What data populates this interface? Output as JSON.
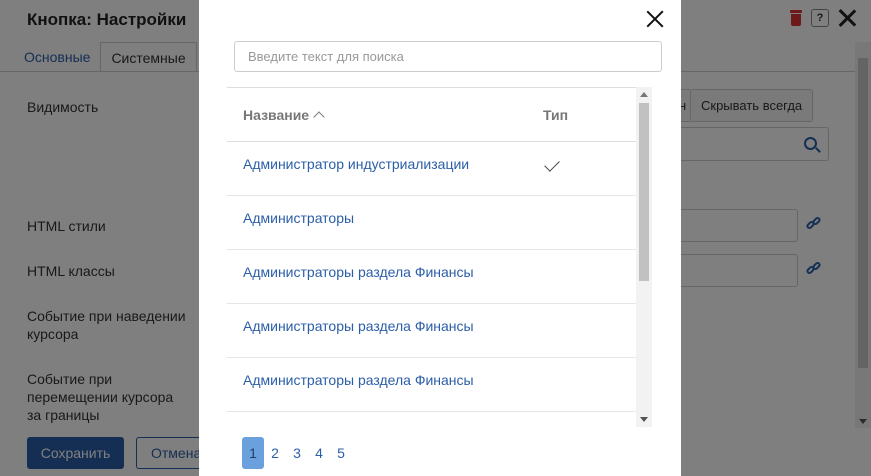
{
  "background": {
    "title": "Кнопка: Настройки",
    "tabs": [
      {
        "label": "Основные"
      },
      {
        "label": "Системные"
      }
    ],
    "labels": {
      "visibility": "Видимость",
      "html_styles": "HTML стили",
      "html_classes": "HTML классы",
      "hover_event": "Событие при наведении курсора",
      "leave_event": "Событие при перемещении курсора за границы"
    },
    "visibility_button_fragment": "н",
    "hide_always_button": "Скрывать всегда",
    "save_button": "Сохранить",
    "cancel_button": "Отмена"
  },
  "modal": {
    "search_placeholder": "Введите текст для поиска",
    "columns": {
      "name": "Название",
      "type": "Тип"
    },
    "rows": [
      {
        "name": "Администратор индустриализации",
        "checked": true
      },
      {
        "name": "Администраторы",
        "checked": false
      },
      {
        "name": "Администраторы раздела Финансы",
        "checked": false
      },
      {
        "name": "Администраторы раздела Финансы",
        "checked": false
      },
      {
        "name": "Администраторы раздела Финансы",
        "checked": false
      }
    ],
    "pages": [
      "1",
      "2",
      "3",
      "4",
      "5"
    ],
    "active_page": "1"
  },
  "colors": {
    "accent": "#2b5ea8",
    "active_page_bg": "#6aa1dc",
    "delete_icon": "#dd3333"
  }
}
